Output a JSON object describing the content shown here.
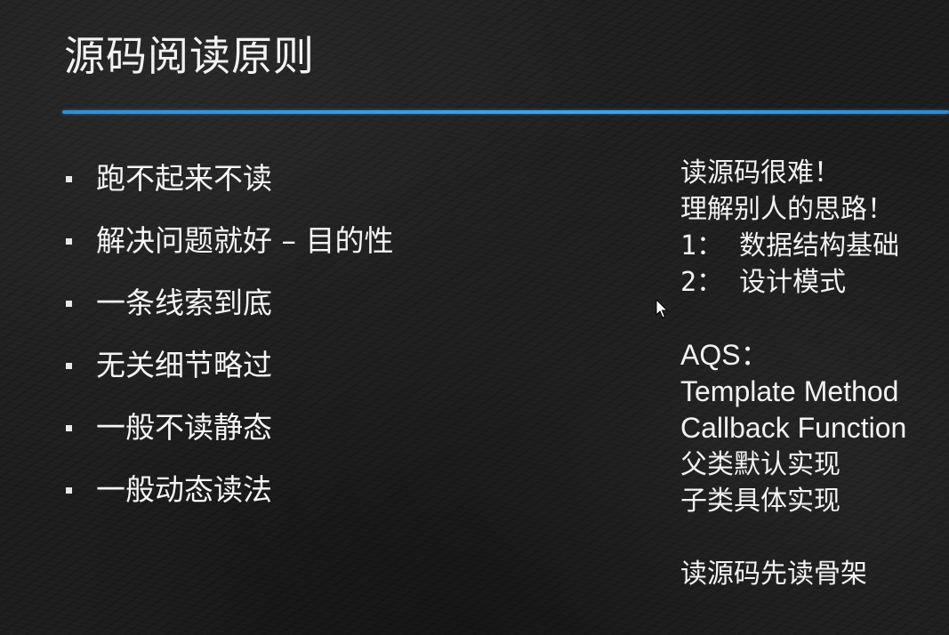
{
  "slide": {
    "title": "源码阅读原则",
    "accent_color": "#3aa6ee"
  },
  "bullets": [
    "跑不起来不读",
    "解决问题就好 – 目的性",
    "一条线索到底",
    "无关细节略过",
    "一般不读静态",
    "一般动态读法"
  ],
  "notes": {
    "line1": "读源码很难！",
    "line2": "理解别人的思路！",
    "line3": "1：  数据结构基础",
    "line4": "2：  设计模式",
    "line5": "AQS：",
    "line6": "Template Method",
    "line7": "Callback Function",
    "line8": "父类默认实现",
    "line9": "子类具体实现",
    "line10": "读源码先读骨架"
  },
  "icons": {
    "cursor": "mouse-pointer-icon"
  }
}
